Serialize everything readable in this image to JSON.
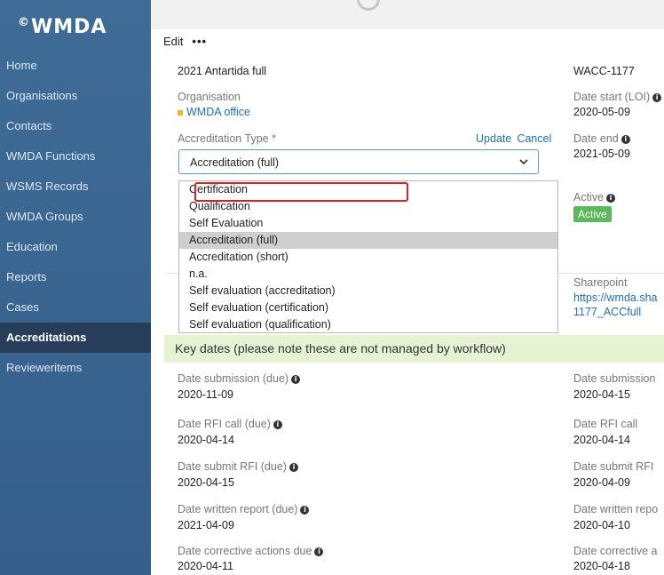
{
  "brand": {
    "logo_text": "WMDA",
    "logo_mark": "©"
  },
  "nav": [
    {
      "label": "Home"
    },
    {
      "label": "Organisations"
    },
    {
      "label": "Contacts"
    },
    {
      "label": "WMDA Functions"
    },
    {
      "label": "WSMS Records"
    },
    {
      "label": "WMDA Groups"
    },
    {
      "label": "Education"
    },
    {
      "label": "Reports"
    },
    {
      "label": "Cases"
    },
    {
      "label": "Accreditations"
    },
    {
      "label": "Revieweritems"
    }
  ],
  "active_nav": "Accreditations",
  "toolbar": {
    "edit_label": "Edit",
    "more_label": "•••"
  },
  "record": {
    "name_value": "2021 Antartida full",
    "code_value": "WACC-1177",
    "organisation_label": "Organisation",
    "organisation_value": "WMDA office",
    "date_start_label": "Date start (LOI)",
    "date_start_value": "2020-05-09",
    "accreditation_type_label": "Accreditation Type *",
    "update_label": "Update",
    "cancel_label": "Cancel",
    "date_end_label": "Date end",
    "date_end_value": "2021-05-09",
    "accreditation_type_value": "Accreditation (full)",
    "active_label": "Active",
    "active_badge": "Active",
    "sharepoint_label": "Sharepoint",
    "sharepoint_link_1": "https://wmda.sha",
    "sharepoint_link_2": "1177_ACCfull"
  },
  "dropdown": {
    "options": [
      "Certification",
      "Qualification",
      "Self Evaluation",
      "Accreditation (full)",
      "Accreditation (short)",
      "n.a.",
      "Self evaluation (accreditation)",
      "Self evaluation (certification)",
      "Self evaluation (qualification)"
    ],
    "selected": "Accreditation (full)",
    "highlighted": "Certification"
  },
  "key_dates": {
    "banner": "Key dates (please note these are not managed by workflow)",
    "left": [
      {
        "label": "Date submission (due)",
        "value": "2020-11-09"
      },
      {
        "label": "Date RFI call (due)",
        "value": "2020-04-14"
      },
      {
        "label": "Date submit RFI (due)",
        "value": "2020-04-15"
      },
      {
        "label": "Date written report (due)",
        "value": "2021-04-09"
      },
      {
        "label": "Date corrective actions due",
        "value": "2020-04-11"
      }
    ],
    "right": [
      {
        "label": "Date submission",
        "value": "2020-04-15"
      },
      {
        "label": "Date RFI call",
        "value": "2020-04-14"
      },
      {
        "label": "Date submit RFI",
        "value": "2020-04-09"
      },
      {
        "label": "Date written repo",
        "value": "2020-04-10"
      },
      {
        "label": "Date corrective a",
        "value": "2020-04-18"
      }
    ]
  },
  "colors": {
    "sidebar": "#3a6591",
    "sidebar_active": "#273e5a",
    "accent": "#1f6fb5",
    "highlight": "#e01f1f",
    "banner": "#e5f3d2",
    "badge": "#5cb85c"
  }
}
